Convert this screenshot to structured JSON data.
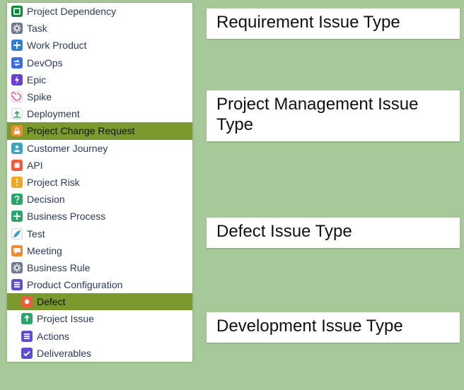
{
  "sidebar": {
    "items": [
      {
        "label": "Project Dependency",
        "icon": "pd-icon",
        "selected": false,
        "indent": false
      },
      {
        "label": "Task",
        "icon": "task-icon",
        "selected": false,
        "indent": false
      },
      {
        "label": "Work Product",
        "icon": "work-product-icon",
        "selected": false,
        "indent": false
      },
      {
        "label": "DevOps",
        "icon": "devops-icon",
        "selected": false,
        "indent": false
      },
      {
        "label": "Epic",
        "icon": "epic-icon",
        "selected": false,
        "indent": false
      },
      {
        "label": "Spike",
        "icon": "spike-icon",
        "selected": false,
        "indent": false
      },
      {
        "label": "Deployment",
        "icon": "deployment-icon",
        "selected": false,
        "indent": false
      },
      {
        "label": "Project Change Request",
        "icon": "pcr-icon",
        "selected": true,
        "indent": false
      },
      {
        "label": "Customer Journey",
        "icon": "journey-icon",
        "selected": false,
        "indent": false
      },
      {
        "label": "API",
        "icon": "api-icon",
        "selected": false,
        "indent": false
      },
      {
        "label": "Project Risk",
        "icon": "risk-icon",
        "selected": false,
        "indent": false
      },
      {
        "label": "Decision",
        "icon": "decision-icon",
        "selected": false,
        "indent": false
      },
      {
        "label": "Business Process",
        "icon": "bp-icon",
        "selected": false,
        "indent": false
      },
      {
        "label": "Test",
        "icon": "test-icon",
        "selected": false,
        "indent": false
      },
      {
        "label": "Meeting",
        "icon": "meeting-icon",
        "selected": false,
        "indent": false
      },
      {
        "label": "Business Rule",
        "icon": "rule-icon",
        "selected": false,
        "indent": false
      },
      {
        "label": "Product Configuration",
        "icon": "config-icon",
        "selected": false,
        "indent": false
      },
      {
        "label": "Defect",
        "icon": "defect-icon",
        "selected": true,
        "indent": true
      },
      {
        "label": "Project Issue",
        "icon": "issue-icon",
        "selected": false,
        "indent": true
      },
      {
        "label": "Actions",
        "icon": "actions-icon",
        "selected": false,
        "indent": true
      },
      {
        "label": "Deliverables",
        "icon": "deliverables-icon",
        "selected": false,
        "indent": true
      }
    ]
  },
  "callouts": [
    {
      "text": "Requirement Issue Type"
    },
    {
      "text": "Project Management Issue Type"
    },
    {
      "text": "Defect Issue Type"
    },
    {
      "text": "Development Issue Type"
    }
  ],
  "icon_defs": {
    "pd-icon": {
      "bg": "#0b8a3e",
      "glyph": "box",
      "fg": "#ffffff"
    },
    "task-icon": {
      "bg": "#6b7a90",
      "glyph": "gear",
      "fg": "#ffffff"
    },
    "work-product-icon": {
      "bg": "#2e7dd7",
      "glyph": "plus",
      "fg": "#ffffff"
    },
    "devops-icon": {
      "bg": "#3a6de0",
      "glyph": "arrows",
      "fg": "#ffffff"
    },
    "epic-icon": {
      "bg": "#6b3fd6",
      "glyph": "bolt",
      "fg": "#ffffff"
    },
    "spike-icon": {
      "bg": "#ffffff",
      "glyph": "spiral",
      "fg": "#f0628a"
    },
    "deployment-icon": {
      "bg": "#ffffff",
      "glyph": "upload",
      "fg": "#3aa559"
    },
    "pcr-icon": {
      "bg": "#f08a2a",
      "glyph": "lock",
      "fg": "#ffffff"
    },
    "journey-icon": {
      "bg": "#3aa5c0",
      "glyph": "user",
      "fg": "#ffffff"
    },
    "api-icon": {
      "bg": "#f35b3a",
      "glyph": "square",
      "fg": "#ffffff"
    },
    "risk-icon": {
      "bg": "#f5a623",
      "glyph": "excl",
      "fg": "#ffffff"
    },
    "decision-icon": {
      "bg": "#2aa56a",
      "glyph": "quest",
      "fg": "#ffffff"
    },
    "bp-icon": {
      "bg": "#2aa56a",
      "glyph": "plus",
      "fg": "#ffffff"
    },
    "test-icon": {
      "bg": "#ffffff",
      "glyph": "feather",
      "fg": "#3a9bd6"
    },
    "meeting-icon": {
      "bg": "#f08a2a",
      "glyph": "talk",
      "fg": "#ffffff"
    },
    "rule-icon": {
      "bg": "#6b7a90",
      "glyph": "gear",
      "fg": "#ffffff"
    },
    "config-icon": {
      "bg": "#5a4fd6",
      "glyph": "lines",
      "fg": "#ffffff"
    },
    "defect-icon": {
      "bg": "#f35b3a",
      "glyph": "circle",
      "fg": "#ffffff"
    },
    "issue-icon": {
      "bg": "#2aa56a",
      "glyph": "up",
      "fg": "#ffffff"
    },
    "actions-icon": {
      "bg": "#5a4fd6",
      "glyph": "lines",
      "fg": "#ffffff"
    },
    "deliverables-icon": {
      "bg": "#5a4fd6",
      "glyph": "check",
      "fg": "#ffffff"
    }
  }
}
